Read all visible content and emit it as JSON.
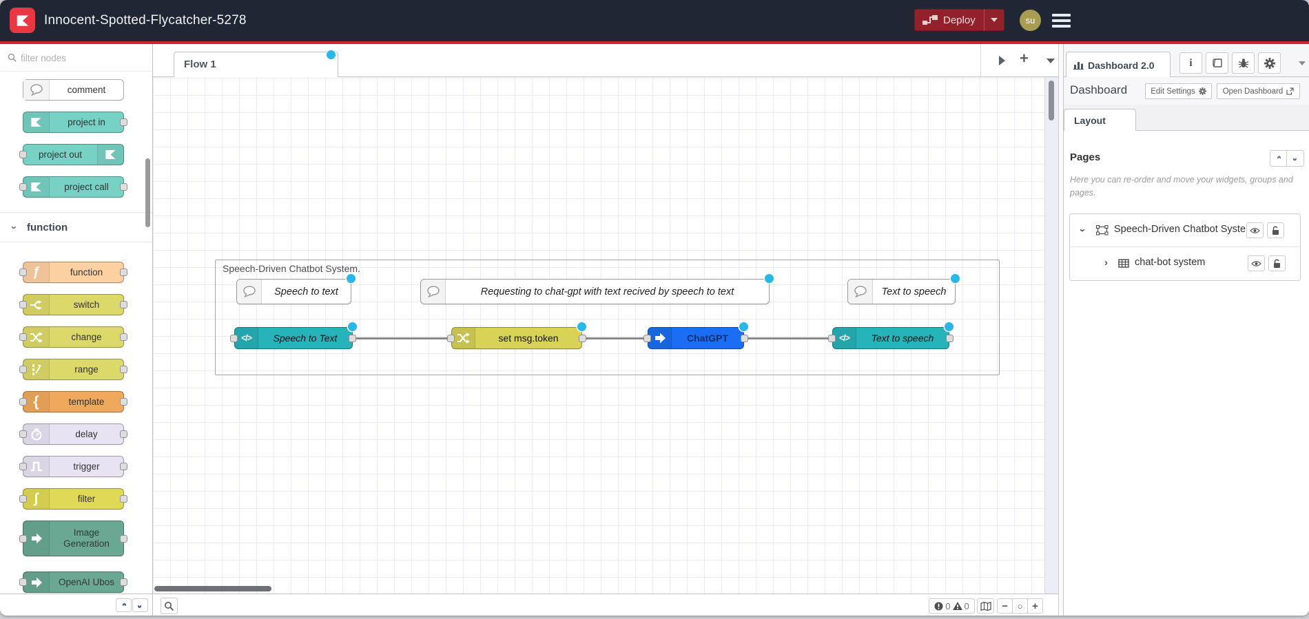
{
  "header": {
    "title": "Innocent-Spotted-Flycatcher-5278",
    "deploy_label": "Deploy",
    "avatar_initials": "su"
  },
  "palette": {
    "filter_placeholder": "filter nodes",
    "section_function": "function",
    "nodes": [
      {
        "label": "comment"
      },
      {
        "label": "project in"
      },
      {
        "label": "project out"
      },
      {
        "label": "project call"
      },
      {
        "label": "function"
      },
      {
        "label": "switch"
      },
      {
        "label": "change"
      },
      {
        "label": "range"
      },
      {
        "label": "template"
      },
      {
        "label": "delay"
      },
      {
        "label": "trigger"
      },
      {
        "label": "filter"
      },
      {
        "label": "Image Generation"
      },
      {
        "label": "OpenAI Ubos"
      }
    ]
  },
  "workspace": {
    "tab_label": "Flow 1"
  },
  "flow": {
    "group_label": "Speech-Driven Chatbot System.",
    "comments": [
      {
        "label": "Speech to text"
      },
      {
        "label": "Requesting to chat-gpt with text recived by speech to text"
      },
      {
        "label": "Text to speech"
      }
    ],
    "nodes": [
      {
        "label": "Speech to Text"
      },
      {
        "label": "set msg.token"
      },
      {
        "label": "ChatGPT"
      },
      {
        "label": "Text to speech"
      }
    ]
  },
  "sidebar": {
    "tab_label": "Dashboard 2.0",
    "heading": "Dashboard",
    "edit_settings_label": "Edit Settings",
    "open_dashboard_label": "Open Dashboard",
    "layout_tab_label": "Layout",
    "pages_heading": "Pages",
    "pages_help": "Here you can re-order and move your widgets, groups and pages.",
    "tree": [
      {
        "label": "Speech-Driven Chatbot System"
      },
      {
        "label": "chat-bot system"
      }
    ]
  },
  "statusbar": {
    "error_count": "0",
    "warning_count": "0"
  },
  "icons": {
    "glyph_function": "ƒ",
    "glyph_template": "{",
    "glyph_filter": "∫",
    "glyph_code": "</>",
    "glyph_minus": "−",
    "glyph_circle": "○",
    "glyph_plus": "+",
    "names": "ubos-logo, deploy, hamburger, search, comment-bubble, arrow, info, docs, debug, settings, eye, lock-open, map, error-circle, warning-triangle, external-link, bar-chart"
  },
  "colors": {
    "header_bg": "#202634",
    "accent_red": "#cd2630",
    "logo_red": "#e93744",
    "deploy_red": "#93212b",
    "avatar_olive": "#a89d52",
    "node_project_teal": "#77d1c4",
    "node_function_orange": "#fdd0a2",
    "node_switch_yellow": "#ddd86a",
    "node_template_orange": "#f0a85c",
    "node_delay_lavender": "#e7e3f3",
    "node_filter_yellow": "#e0d957",
    "node_green": "#6aa894",
    "flow_teal": "#27b3ba",
    "flow_yellow": "#d8d356",
    "flow_blue": "#1b6ef3",
    "changed_dot_cyan": "#29b6e8",
    "grid_line": "#e9ebf5"
  }
}
